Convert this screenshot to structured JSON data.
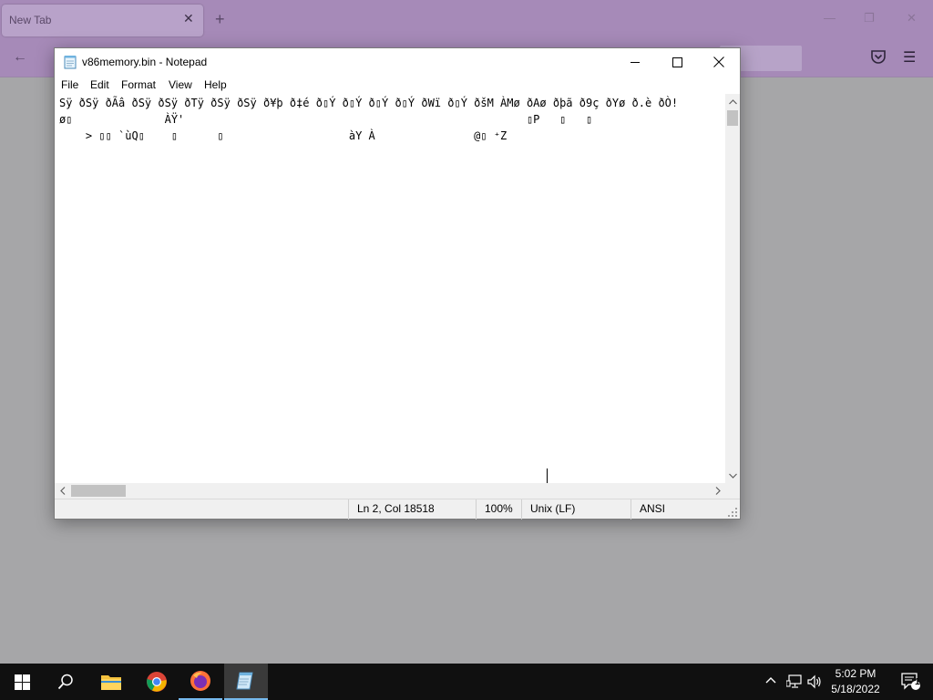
{
  "browser": {
    "tab_title": "New Tab",
    "tab_close": "✕",
    "new_tab": "+",
    "back": "←",
    "menu": "☰",
    "win_min": "—",
    "win_max": "❐",
    "win_close": "✕"
  },
  "notepad": {
    "title": "v86memory.bin - Notepad",
    "menu": [
      "File",
      "Edit",
      "Format",
      "View",
      "Help"
    ],
    "content_lines": [
      "Sÿ ðSÿ ðÃâ ðSÿ ðSÿ ðTÿ ðSÿ ðSÿ ð¥þ ð‡é ð▯Ý ð▯Ý ð▯Ý ð▯Ý ðWï ð▯Ý ðšM ÀMø ðAø ðþã ð9ç ðYø ð.è ðÒ!",
      "ø▯              ÀŸ'                                                    ▯P   ▯   ▯",
      "    > ▯▯ `ùQ▯    ▯      ▯                   àY À               @▯ ⁺Z"
    ],
    "status": {
      "position": "Ln 2, Col 18518",
      "zoom": "100%",
      "line_ending": "Unix (LF)",
      "encoding": "ANSI"
    }
  },
  "taskbar": {
    "time": "5:02 PM",
    "date": "5/18/2022",
    "notification_count": "1",
    "apps": [
      "start",
      "search",
      "file-explorer",
      "chrome",
      "firefox",
      "notepad"
    ]
  }
}
